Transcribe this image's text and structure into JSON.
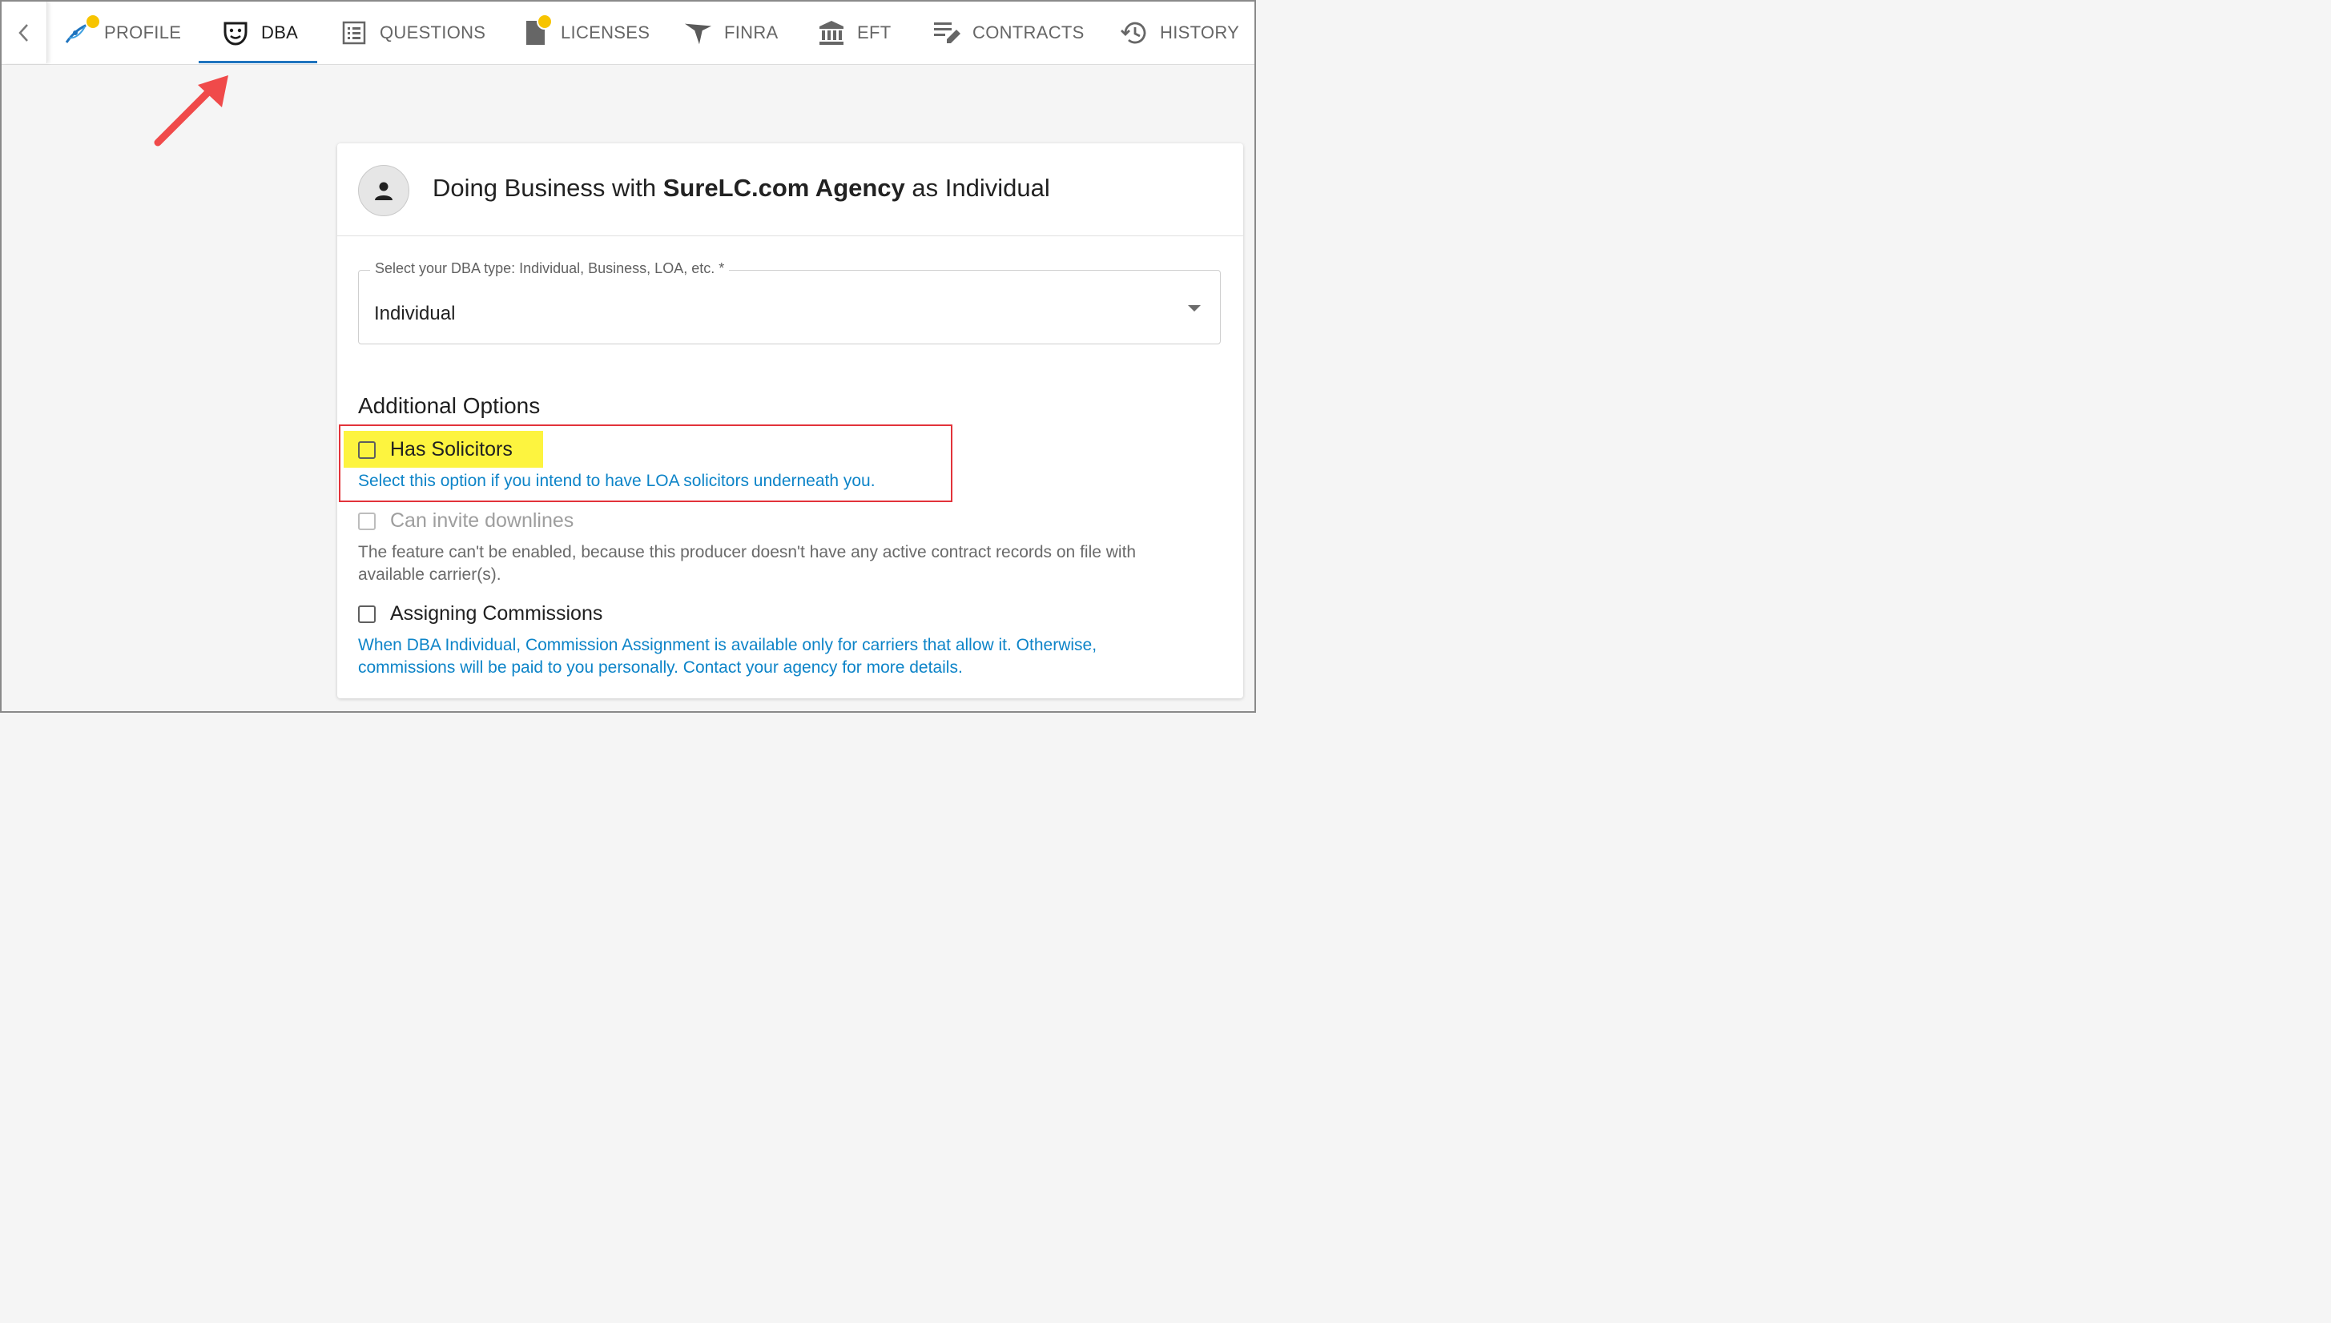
{
  "tabs": [
    {
      "label": "PROFILE",
      "icon": "profile-swoosh-icon",
      "badge": true
    },
    {
      "label": "DBA",
      "icon": "theater-mask-icon",
      "active": true
    },
    {
      "label": "QUESTIONS",
      "icon": "list-document-icon"
    },
    {
      "label": "LICENSES",
      "icon": "license-document-icon",
      "badge": true
    },
    {
      "label": "FINRA",
      "icon": "finra-arrow-icon"
    },
    {
      "label": "EFT",
      "icon": "bank-icon"
    },
    {
      "label": "CONTRACTS",
      "icon": "contract-edit-icon"
    },
    {
      "label": "HISTORY",
      "icon": "history-clock-icon"
    }
  ],
  "card": {
    "title_prefix": "Doing Business with ",
    "title_agency": "SureLC.com Agency",
    "title_suffix": " as Individual",
    "select_label": "Select your DBA type: Individual, Business, LOA, etc. *",
    "select_value": "Individual",
    "section_title": "Additional Options",
    "options": [
      {
        "label": "Has Solicitors",
        "checked": false,
        "disabled": false,
        "hint": "Select this option if you intend to have LOA solicitors underneath you."
      },
      {
        "label": "Can invite downlines",
        "checked": false,
        "disabled": true,
        "hint_line1": "The feature can't be enabled, because this producer doesn't have any active contract records on file with",
        "hint_line2": "available carrier(s)."
      },
      {
        "label": "Assigning Commissions",
        "checked": false,
        "disabled": false,
        "hint_line1": "When DBA Individual, Commission Assignment is available only for carriers that allow it. Otherwise,",
        "hint_line2": "commissions will be paid to you personally. Contact your agency for more details."
      }
    ]
  },
  "colors": {
    "accent": "#1e73be",
    "hint_blue": "#0d84c8",
    "badge_yellow": "#f7c400",
    "annotation_red": "#e2333a",
    "highlight_yellow": "#fdf43f"
  }
}
